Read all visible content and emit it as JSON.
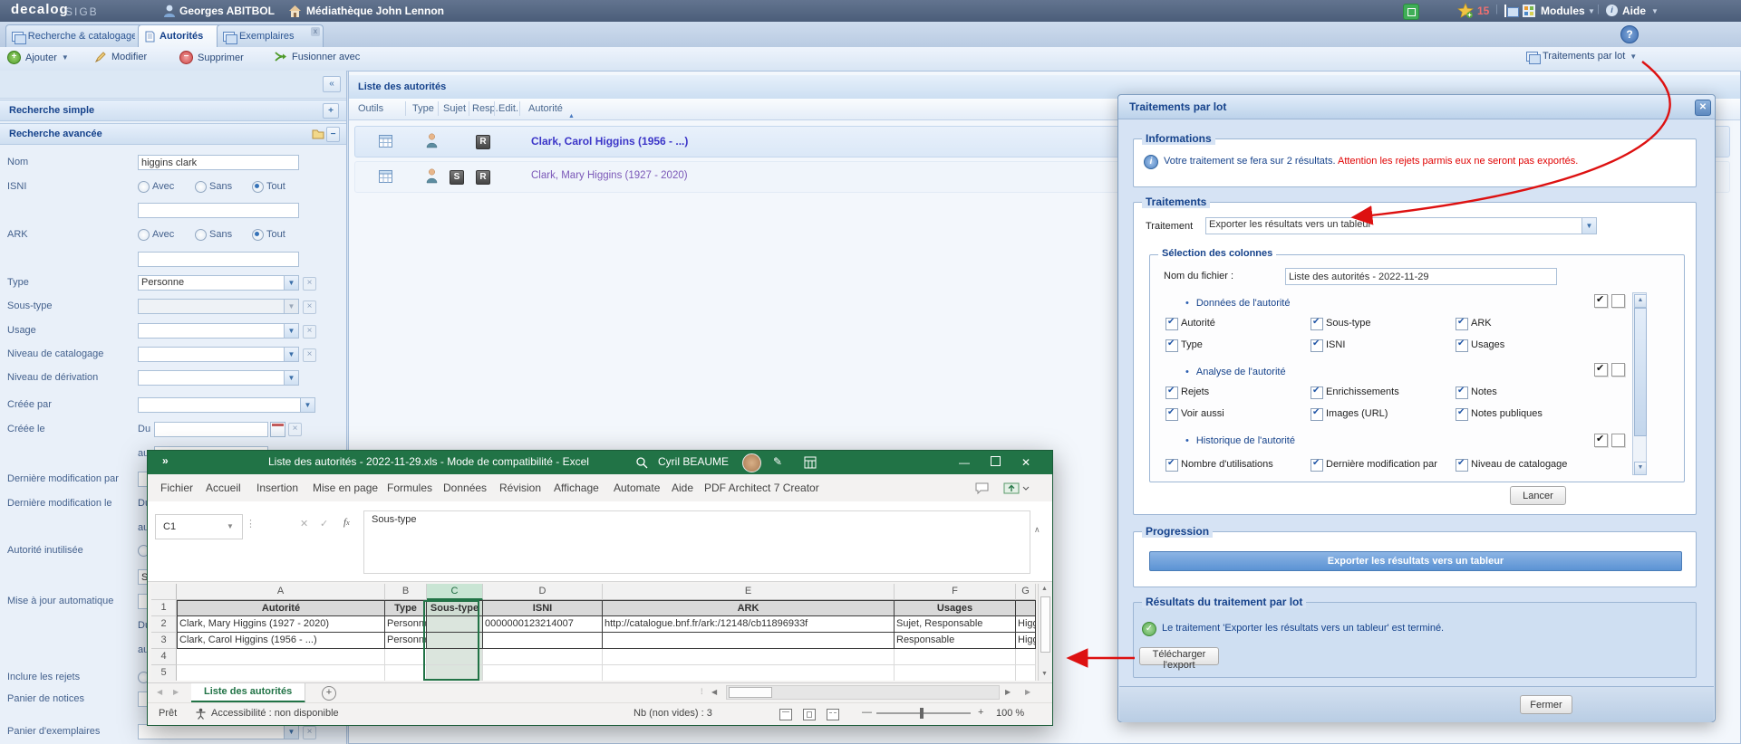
{
  "colors": {
    "accent": "#15428b",
    "excel_green": "#217346",
    "arrow_red": "#dd1111",
    "warning_red": "#e00000",
    "selection_blue": "#dbe8f7"
  },
  "topbar": {
    "logo": "decalog",
    "logo_suffix": "SIGB",
    "user": "Georges ABITBOL",
    "library": "Médiathèque John Lennon",
    "badge_count": "15",
    "modules": "Modules",
    "aide": "Aide"
  },
  "tabs": {
    "tab1": "Recherche & catalogage",
    "tab2": "Autorités",
    "tab3": "Exemplaires"
  },
  "toolbar": {
    "ajouter": "Ajouter",
    "modifier": "Modifier",
    "supprimer": "Supprimer",
    "fusionner": "Fusionner avec",
    "traitements": "Traitements par lot"
  },
  "search": {
    "simple": "Recherche simple",
    "avancee": "Recherche avancée",
    "nom": "Nom",
    "nom_value": "higgins clark",
    "isni": "ISNI",
    "ark": "ARK",
    "avec": "Avec",
    "sans": "Sans",
    "tout": "Tout",
    "type": "Type",
    "type_value": "Personne",
    "sous_type": "Sous-type",
    "usage": "Usage",
    "niveau_catalogage": "Niveau de catalogage",
    "niveau_derivation": "Niveau de dérivation",
    "creee_par": "Créée par",
    "creee_le": "Créée le",
    "du": "Du",
    "au": "au",
    "derniere_modification_par": "Dernière modification par",
    "derniere_modification_le": "Dernière modification le",
    "autorite_inutilisee": "Autorité inutilisée",
    "mise_a_jour_automatique": "Mise à jour automatique",
    "inclure_les_rejets": "Inclure les rejets",
    "panier_de_notices": "Panier de notices",
    "panier_exemplaires": "Panier d'exemplaires"
  },
  "list": {
    "title": "Liste des autorités",
    "col_outils": "Outils",
    "col_type": "Type",
    "col_sujet": "Sujet",
    "col_resp": "Resp.",
    "col_edit": "Edit.",
    "col_autorite": "Autorité",
    "row1": {
      "autorite": "Clark, Carol Higgins (1956 - ...)",
      "resp": "R"
    },
    "row2": {
      "autorite": "Clark, Mary Higgins (1927 - 2020)",
      "sujet": "S",
      "resp": "R"
    }
  },
  "dialog": {
    "title": "Traitements par lot",
    "info_legend": "Informations",
    "info_text": "Votre traitement se fera sur 2 résultats.",
    "info_warning": "Attention les rejets parmis eux ne seront pas exportés.",
    "traitements_legend": "Traitements",
    "traitement_label": "Traitement",
    "traitement_value": "Exporter les résultats vers un tableur",
    "selection_legend": "Sélection des colonnes",
    "filename_label": "Nom du fichier :",
    "filename_value": "Liste des autorités - 2022-11-29",
    "group1": "Données de l'autorité",
    "g1": [
      "Autorité",
      "Sous-type",
      "ARK",
      "Type",
      "ISNI",
      "Usages"
    ],
    "group2": "Analyse de l'autorité",
    "g2": [
      "Rejets",
      "Enrichissements",
      "Notes",
      "Voir aussi",
      "Images (URL)",
      "Notes publiques"
    ],
    "group3": "Histor. de l'autorité",
    "group3_full": "Historique de l'autorité",
    "g3": [
      "Nombre d'utilisations",
      "Dernière modification par",
      "Niveau de catalogage"
    ],
    "lancer": "Lancer",
    "progression_legend": "Progression",
    "progress_text": "Exporter les résultats vers un tableur",
    "resultats_legend": "Résultats du traitement par lot",
    "resultats_message": "Le traitement 'Exporter les résultats vers un tableur' est terminé.",
    "telecharger": "Télécharger l'export",
    "fermer": "Fermer"
  },
  "excel": {
    "title": "Liste des autorités - 2022-11-29.xls  -  Mode de compatibilité  -  Excel",
    "user": "Cyril BEAUME",
    "tabs": [
      "Fichier",
      "Accueil",
      "Insertion",
      "Mise en page",
      "Formules",
      "Données",
      "Révision",
      "Affichage",
      "Automate",
      "Aide",
      "PDF Architect 7 Creator"
    ],
    "name_box": "C1",
    "formula": "Sous-type",
    "cols": [
      "A",
      "B",
      "C",
      "D",
      "E",
      "F",
      "G"
    ],
    "rows": [
      "1",
      "2",
      "3",
      "4",
      "5"
    ],
    "headers": [
      "Autorité",
      "Type",
      "Sous-type",
      "ISNI",
      "ARK",
      "Usages"
    ],
    "r2": [
      "Clark, Mary Higgins (1927 - 2020)",
      "Personne",
      "",
      "0000000123214007",
      "http://catalogue.bnf.fr/ark:/12148/cb11896933f",
      "Sujet, Responsable",
      "Higg"
    ],
    "r3": [
      "Clark, Carol Higgins (1956 - ...)",
      "Personne",
      "",
      "",
      "",
      "Responsable",
      "Higg"
    ],
    "sheet": "Liste des autorités",
    "ready": "Prêt",
    "accessibility": "Accessibilité : non disponible",
    "count": "Nb (non vides) : 3",
    "zoom": "100 %"
  }
}
